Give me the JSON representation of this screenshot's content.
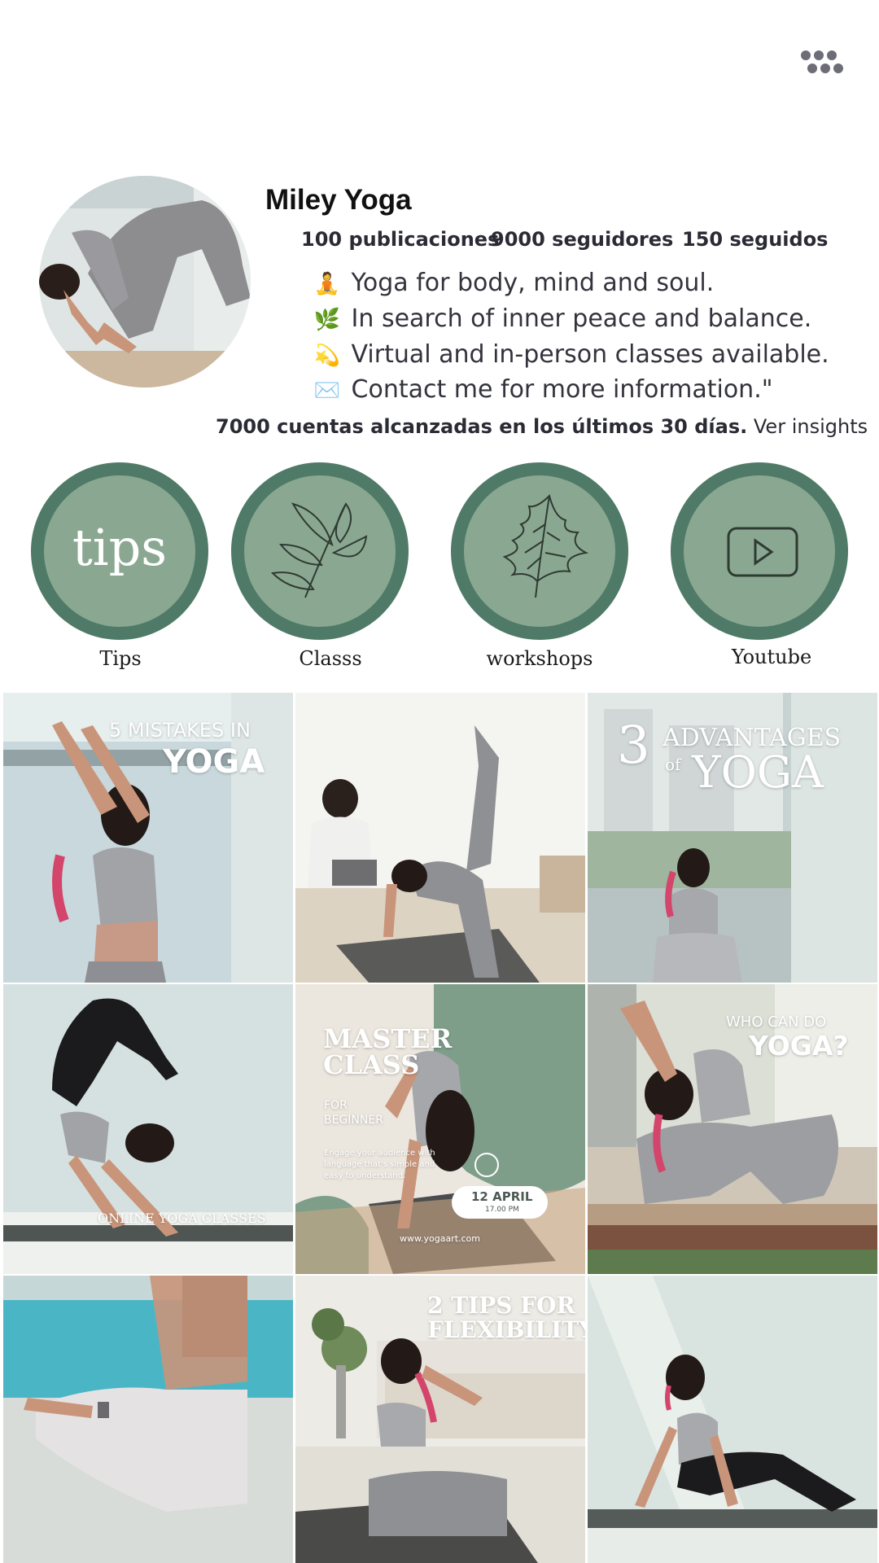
{
  "profile": {
    "username": "Miley Yoga",
    "stats": {
      "posts": "100 publicaciones",
      "followers": "9000 seguidores",
      "following": "150 seguidos"
    },
    "bio": [
      {
        "emoji": "🧘",
        "text": "Yoga for body, mind and soul."
      },
      {
        "emoji": "🌿",
        "text": "In search of inner peace and balance."
      },
      {
        "emoji": "💫",
        "text": "Virtual and in-person classes available."
      },
      {
        "emoji": "✉️",
        "text": "Contact me for more information.\""
      }
    ],
    "reach_bold": "7000 cuentas alcanzadas en los últimos 30 días.",
    "reach_link": "Ver insights"
  },
  "highlights": [
    {
      "label": "Tips",
      "cover_text": "tips",
      "icon": "tips-text-icon"
    },
    {
      "label": "Classs",
      "icon": "leaf-branch-icon"
    },
    {
      "label": "workshops",
      "icon": "leaf-icon"
    },
    {
      "label": "Youtube",
      "icon": "youtube-play-icon"
    }
  ],
  "posts": {
    "p1": {
      "line1": "5 MISTAKES IN",
      "line2": "YOGA"
    },
    "p2": {},
    "p3": {
      "num": "3",
      "line1": "ADVANTAGES",
      "of": "of",
      "line2": "YOGA"
    },
    "p4": {
      "caption": "ONLINE YOGA CLASSES"
    },
    "p5": {
      "title1": "MASTER",
      "title2": "CLASS",
      "sub1": "FOR",
      "sub2": "BEGINNER",
      "body1": "Engage your audience with",
      "body2": "language that's simple and",
      "body3": "easy to understand.",
      "date": "12 APRIL",
      "time": "17.00 PM",
      "url": "www.yogaart.com"
    },
    "p6": {
      "line1": "WHO CAN DO",
      "line2": "YOGA?"
    },
    "p7": {},
    "p8": {
      "line1": "2 TIPS FOR",
      "line2": "FLEXIBILITY"
    },
    "p9": {}
  },
  "colors": {
    "highlight_fill": "#8aa891",
    "highlight_ring": "#4f7a68",
    "accent_green": "#7e9e8a"
  }
}
